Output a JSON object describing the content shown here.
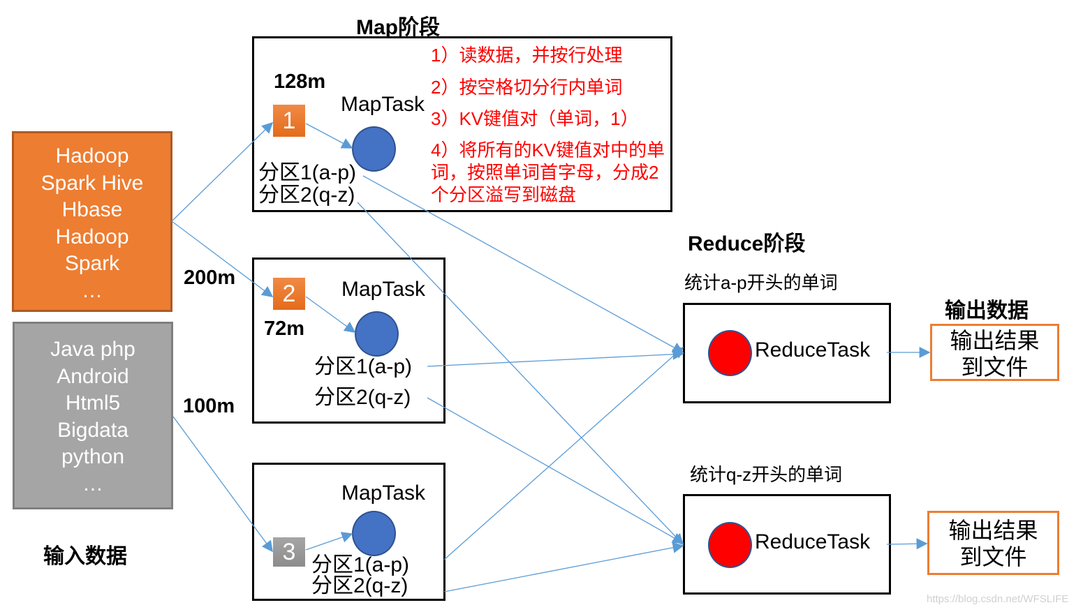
{
  "labels": {
    "map_stage": "Map阶段",
    "reduce_stage": "Reduce阶段",
    "input_data": "输入数据",
    "output_data": "输出数据"
  },
  "inputs": [
    {
      "lines": [
        "Hadoop",
        "Spark Hive",
        "Hbase",
        "Hadoop",
        "Spark",
        "…"
      ],
      "color": "#ed7d31"
    },
    {
      "lines": [
        "Java php",
        "Android",
        "Html5",
        "Bigdata",
        "python",
        "…"
      ],
      "color": "#a5a5a5"
    }
  ],
  "sizes": {
    "split1": "128m",
    "total1": "200m",
    "split2": "72m",
    "total2": "100m"
  },
  "map_tasks": [
    {
      "split_no": "1",
      "title": "MapTask",
      "partitions": [
        "分区1(a-p)",
        "分区2(q-z)"
      ]
    },
    {
      "split_no": "2",
      "title": "MapTask",
      "partitions": [
        "分区1(a-p)",
        "分区2(q-z)"
      ]
    },
    {
      "split_no": "3",
      "title": "MapTask",
      "partitions": [
        "分区1(a-p)",
        "分区2(q-z)"
      ]
    }
  ],
  "map_steps": [
    "1）读数据，并按行处理",
    "2）按空格切分行内单词",
    "3）KV键值对（单词，1）",
    "4）将所有的KV键值对中的单",
    "词，按照单词首字母，分成2",
    "个分区溢写到磁盘"
  ],
  "reduce_tasks": [
    {
      "caption": "统计a-p开头的单词",
      "title": "ReduceTask",
      "output": [
        "输出结果",
        "到文件"
      ]
    },
    {
      "caption": "统计q-z开头的单词",
      "title": "ReduceTask",
      "output": [
        "输出结果",
        "到文件"
      ]
    }
  ],
  "watermark": "https://blog.csdn.net/WFSLIFE",
  "colors": {
    "orange": "#ed7d31",
    "gray": "#a5a5a5",
    "map_circle": "#4472c4",
    "reduce_circle": "#ff0000",
    "arrow": "#5b9bd5",
    "step_text": "#ff0000"
  }
}
